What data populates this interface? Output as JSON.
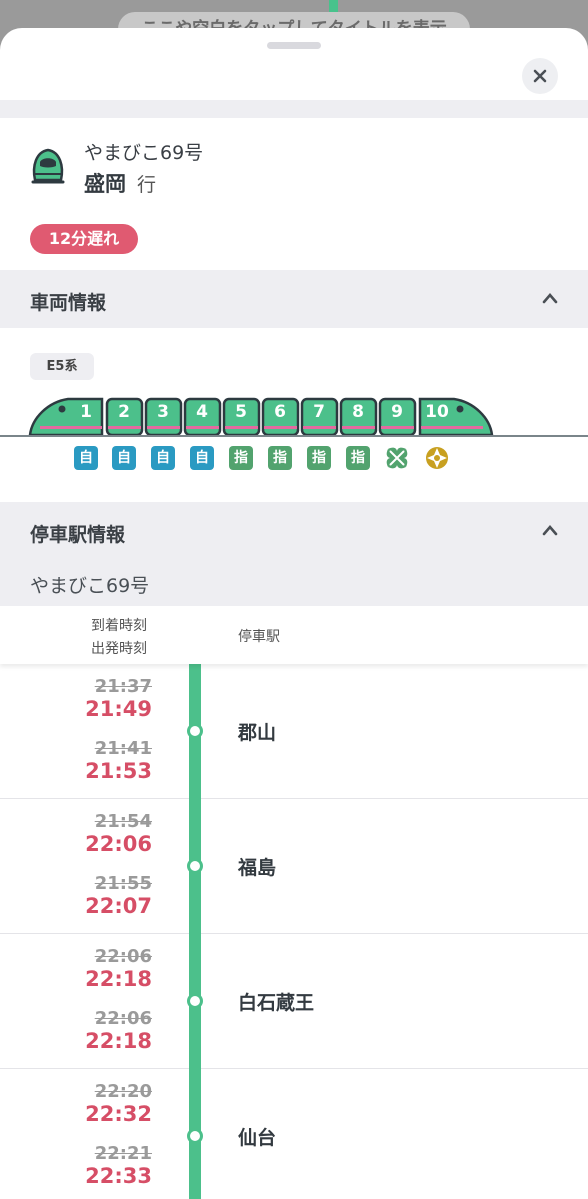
{
  "background": {
    "pill_text": "ここや空白をタップしてタイトルを表示"
  },
  "header": {
    "close_icon": "close-icon"
  },
  "train": {
    "icon": "shinkansen-icon",
    "name": "やまびこ69号",
    "destination": "盛岡",
    "destination_suffix": "行",
    "delay_badge": "12分遅れ"
  },
  "vehicle_section": {
    "title": "車両情報",
    "series": "E5系",
    "cars": [
      "1",
      "2",
      "3",
      "4",
      "5",
      "6",
      "7",
      "8",
      "9",
      "10"
    ],
    "seats": [
      {
        "label": "自",
        "type": "free"
      },
      {
        "label": "自",
        "type": "free"
      },
      {
        "label": "自",
        "type": "free"
      },
      {
        "label": "自",
        "type": "free"
      },
      {
        "label": "指",
        "type": "reserved"
      },
      {
        "label": "指",
        "type": "reserved"
      },
      {
        "label": "指",
        "type": "reserved"
      },
      {
        "label": "指",
        "type": "reserved"
      },
      {
        "label": "",
        "type": "green-car-icon"
      },
      {
        "label": "",
        "type": "gran-class-icon"
      }
    ]
  },
  "stop_section": {
    "title": "停車駅情報",
    "train_name": "やまびこ69号",
    "col_arrival": "到着時刻",
    "col_departure": "出発時刻",
    "col_station": "停車駅",
    "stops": [
      {
        "station": "郡山",
        "arr_old": "21:37",
        "arr_new": "21:49",
        "dep_old": "21:41",
        "dep_new": "21:53"
      },
      {
        "station": "福島",
        "arr_old": "21:54",
        "arr_new": "22:06",
        "dep_old": "21:55",
        "dep_new": "22:07"
      },
      {
        "station": "白石蔵王",
        "arr_old": "22:06",
        "arr_new": "22:18",
        "dep_old": "22:06",
        "dep_new": "22:18"
      },
      {
        "station": "仙台",
        "arr_old": "22:20",
        "arr_new": "22:32",
        "dep_old": "22:21",
        "dep_new": "22:33"
      }
    ]
  },
  "colors": {
    "accent_green": "#4cc08b",
    "delay_red": "#d64e66",
    "free_seat_blue": "#2a9ac2",
    "reserved_seat_green": "#52a36e",
    "gran_class_gold": "#c8a020"
  }
}
